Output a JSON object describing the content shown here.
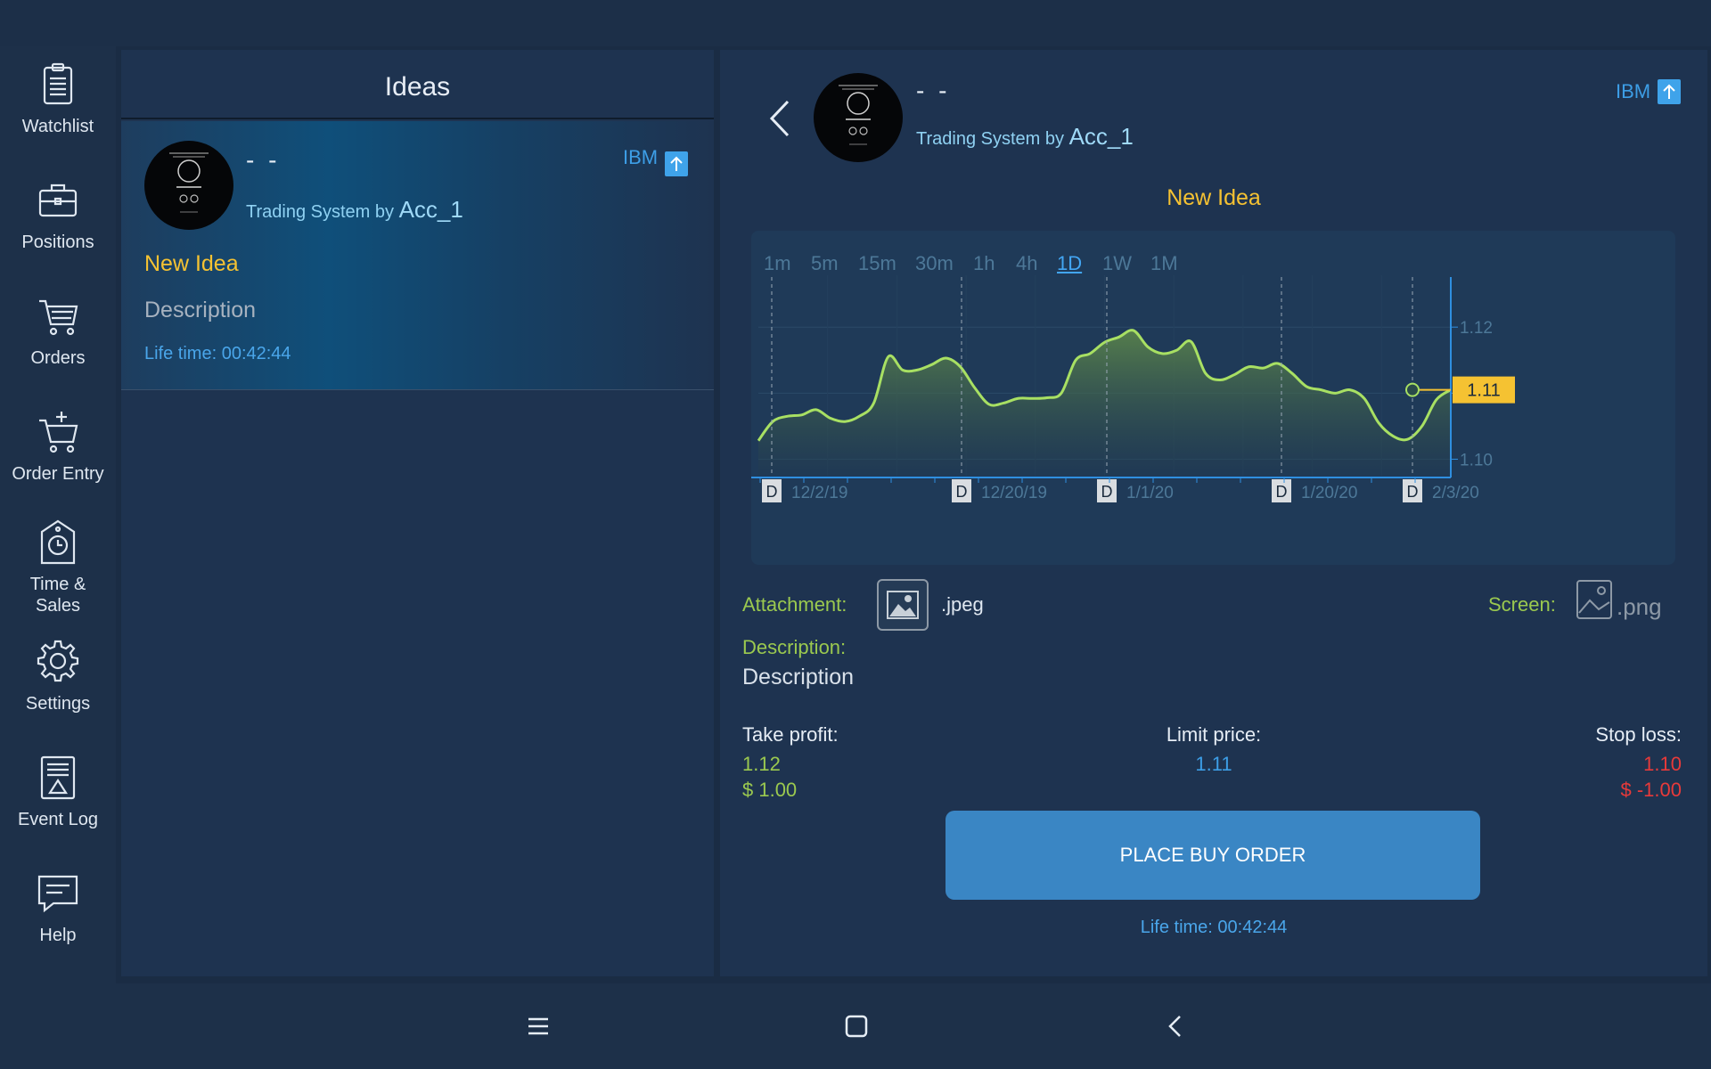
{
  "sidebar": {
    "items": [
      {
        "label": "Watchlist",
        "icon": "clipboard-icon"
      },
      {
        "label": "Positions",
        "icon": "briefcase-icon"
      },
      {
        "label": "Orders",
        "icon": "cart-icon"
      },
      {
        "label": "Order Entry",
        "icon": "cart-plus-icon"
      },
      {
        "label": "Time &\nSales",
        "icon": "clock-tag-icon"
      },
      {
        "label": "Settings",
        "icon": "gear-icon"
      },
      {
        "label": "Event Log",
        "icon": "event-log-icon"
      },
      {
        "label": "Help",
        "icon": "chat-icon"
      }
    ]
  },
  "ideas_panel": {
    "title": "Ideas",
    "card": {
      "name": "- -",
      "system_prefix": "Trading System by",
      "author": "Acc_1",
      "symbol": "IBM",
      "idea_title": "New Idea",
      "description": "Description",
      "lifetime": "Life time: 00:42:44"
    }
  },
  "detail": {
    "name": "- -",
    "system_prefix": "Trading System by",
    "author": "Acc_1",
    "symbol": "IBM",
    "idea_title": "New Idea",
    "timeframes": [
      "1m",
      "5m",
      "15m",
      "30m",
      "1h",
      "4h",
      "1D",
      "1W",
      "1M"
    ],
    "active_timeframe": "1D",
    "attachment_label": "Attachment:",
    "attachment_ext": ".jpeg",
    "screen_label": "Screen:",
    "screen_ext": ".png",
    "description_label": "Description:",
    "description": "Description",
    "take_profit_label": "Take profit:",
    "take_profit": "1.12",
    "take_profit_sub": "$ 1.00",
    "limit_price_label": "Limit price:",
    "limit_price": "1.11",
    "stop_loss_label": "Stop loss:",
    "stop_loss": "1.10",
    "stop_loss_sub": "$ -1.00",
    "button_label": "PLACE BUY ORDER",
    "lifetime": "Life time: 00:42:44"
  },
  "colors": {
    "accent_yellow": "#f5c232",
    "accent_green": "#9bc94f",
    "accent_blue": "#3d9ee6",
    "stop_red": "#e83a3a",
    "line": "#a8e063",
    "button": "#3a86c4"
  },
  "chart_data": {
    "type": "area",
    "y_ticks": [
      "1.12",
      "1.11",
      "1.10"
    ],
    "ylim": [
      1.0975,
      1.1265
    ],
    "current_price": "1.11",
    "current_value": 1.1105,
    "x_tick_labels": [
      {
        "marker": "D",
        "label": "12/2/19"
      },
      {
        "marker": "D",
        "label": "12/20/19"
      },
      {
        "marker": "D",
        "label": "1/1/20"
      },
      {
        "marker": "D",
        "label": "1/20/20"
      },
      {
        "marker": "D",
        "label": "2/3/20"
      }
    ],
    "series": [
      {
        "values": [
          1.1028,
          1.1057,
          1.1065,
          1.1067,
          1.1075,
          1.1062,
          1.1057,
          1.1065,
          1.1085,
          1.1155,
          1.1135,
          1.1135,
          1.1143,
          1.1153,
          1.114,
          1.1108,
          1.1083,
          1.1085,
          1.1092,
          1.1092,
          1.1093,
          1.11,
          1.115,
          1.116,
          1.1177,
          1.1185,
          1.1195,
          1.117,
          1.116,
          1.1165,
          1.1178,
          1.113,
          1.112,
          1.1128,
          1.114,
          1.1138,
          1.1145,
          1.113,
          1.111,
          1.1105,
          1.11,
          1.1105,
          1.1092,
          1.1055,
          1.1035,
          1.103,
          1.105,
          1.109,
          1.1105
        ]
      }
    ]
  }
}
